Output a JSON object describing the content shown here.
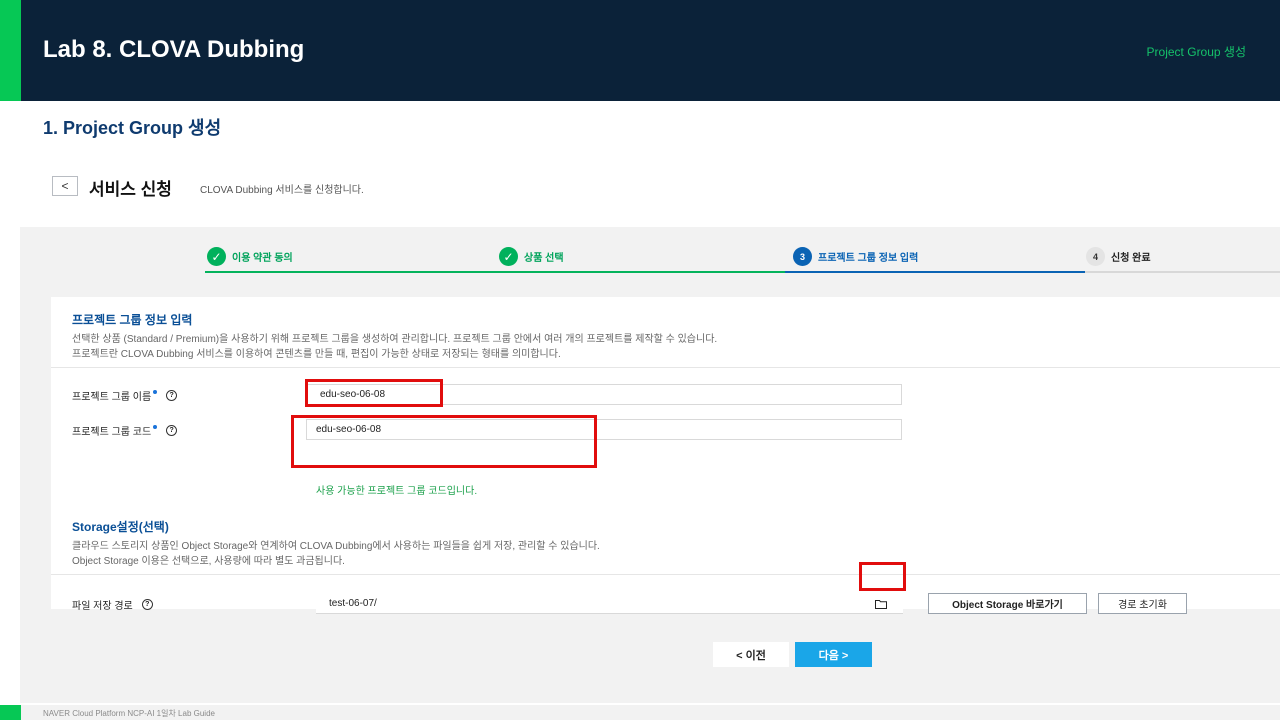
{
  "slide": {
    "title": "Lab 8. CLOVA Dubbing",
    "header_sub": "Project Group 생성",
    "section_title": "1. Project Group 생성",
    "footer": "NAVER Cloud Platform  NCP-AI 1일차 Lab Guide"
  },
  "page": {
    "back_glyph": "<",
    "title": "서비스 신청",
    "subtitle": "CLOVA Dubbing 서비스를 신청합니다."
  },
  "steps": [
    {
      "number": "✓",
      "label": "이용 약관 동의",
      "status": "done"
    },
    {
      "number": "✓",
      "label": "상품 선택",
      "status": "done"
    },
    {
      "number": "3",
      "label": "프로젝트 그룹 정보 입력",
      "status": "current"
    },
    {
      "number": "4",
      "label": "신청 완료",
      "status": "todo"
    }
  ],
  "form": {
    "group_title": "프로젝트 그룹 정보 입력",
    "group_desc_1": "선택한 상품 (Standard / Premium)을 사용하기 위해 프로젝트 그룹을 생성하여 관리합니다. 프로젝트 그룹 안에서 여러 개의 프로젝트를 제작할 수 있습니다.",
    "group_desc_2": "프로젝트란 CLOVA Dubbing 서비스를 이용하여 콘텐츠를 만들 때, 편집이 가능한 상태로 저장되는 형태를 의미합니다.",
    "name_label": "프로젝트 그룹 이름",
    "name_value": "edu-seo-06-08",
    "code_label": "프로젝트 그룹 코드",
    "code_value": "edu-seo-06-08",
    "code_valid_msg": "사용 가능한 프로젝트 그룹 코드입니다.",
    "help_glyph": "?",
    "storage_title": "Storage설정(선택)",
    "storage_desc_1": "클라우드 스토리지 상품인 Object Storage와 연계하여 CLOVA Dubbing에서 사용하는 파일들을 쉽게 저장, 관리할 수 있습니다.",
    "storage_desc_2": "Object Storage 이용은 선택으로, 사용량에 따라 별도 과금됩니다.",
    "path_label": "파일 저장 경로",
    "path_value": "test-06-07/",
    "os_button": "Object Storage 바로가기",
    "reset_button": "경로 초기화"
  },
  "nav": {
    "prev_label": "<  이전",
    "next_label": "다음  >"
  },
  "colors": {
    "header_bg": "#0b2239",
    "accent_green": "#06c855",
    "step_done": "#00b15c",
    "step_current": "#0a63b4",
    "next_button": "#1aa6e8",
    "highlight_box": "#e10d0d"
  }
}
